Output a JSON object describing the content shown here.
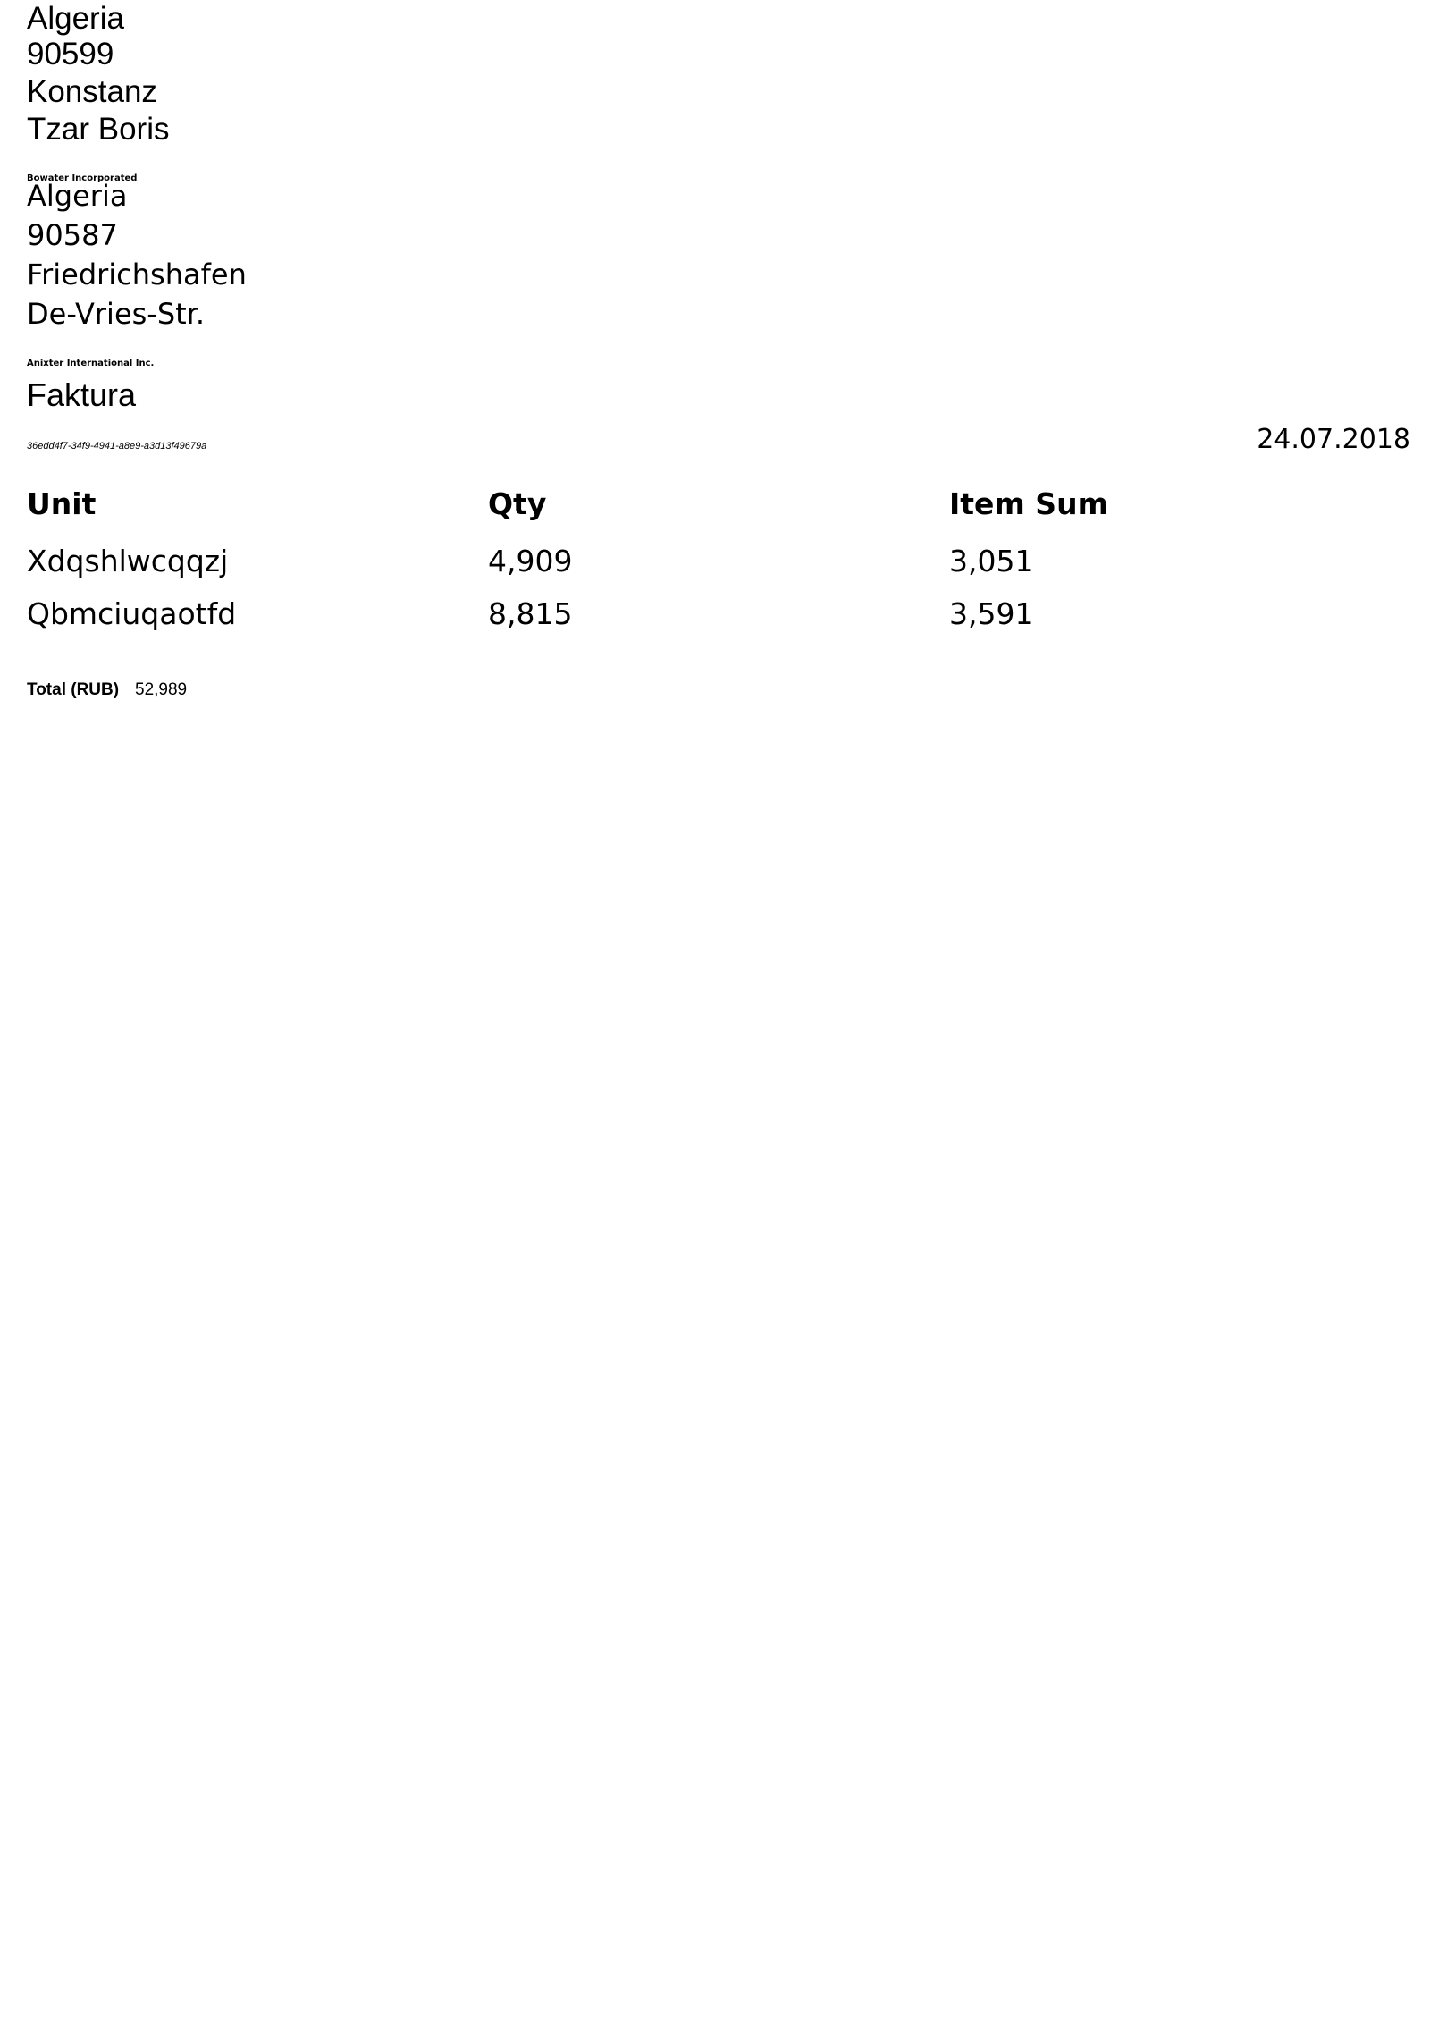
{
  "sender": {
    "country": "Algeria",
    "postal_code": "90599",
    "city": "Konstanz",
    "street": "Tzar Boris",
    "company": "Bowater Incorporated"
  },
  "recipient": {
    "country": "Algeria",
    "postal_code": "90587",
    "city": "Friedrichshafen",
    "street": "De-Vries-Str.",
    "company": "Anixter International Inc."
  },
  "document": {
    "title": "Faktura",
    "id": "36edd4f7-34f9-4941-a8e9-a3d13f49679a",
    "date": "24.07.2018"
  },
  "table": {
    "headers": [
      "Unit",
      "Qty",
      "Item Sum"
    ],
    "rows": [
      [
        "Xdqshlwcqqzj",
        "4,909",
        "3,051"
      ],
      [
        "Qbmciuqaotfd",
        "8,815",
        "3,591"
      ]
    ]
  },
  "total": {
    "label": "Total (RUB)",
    "value": "52,989"
  }
}
